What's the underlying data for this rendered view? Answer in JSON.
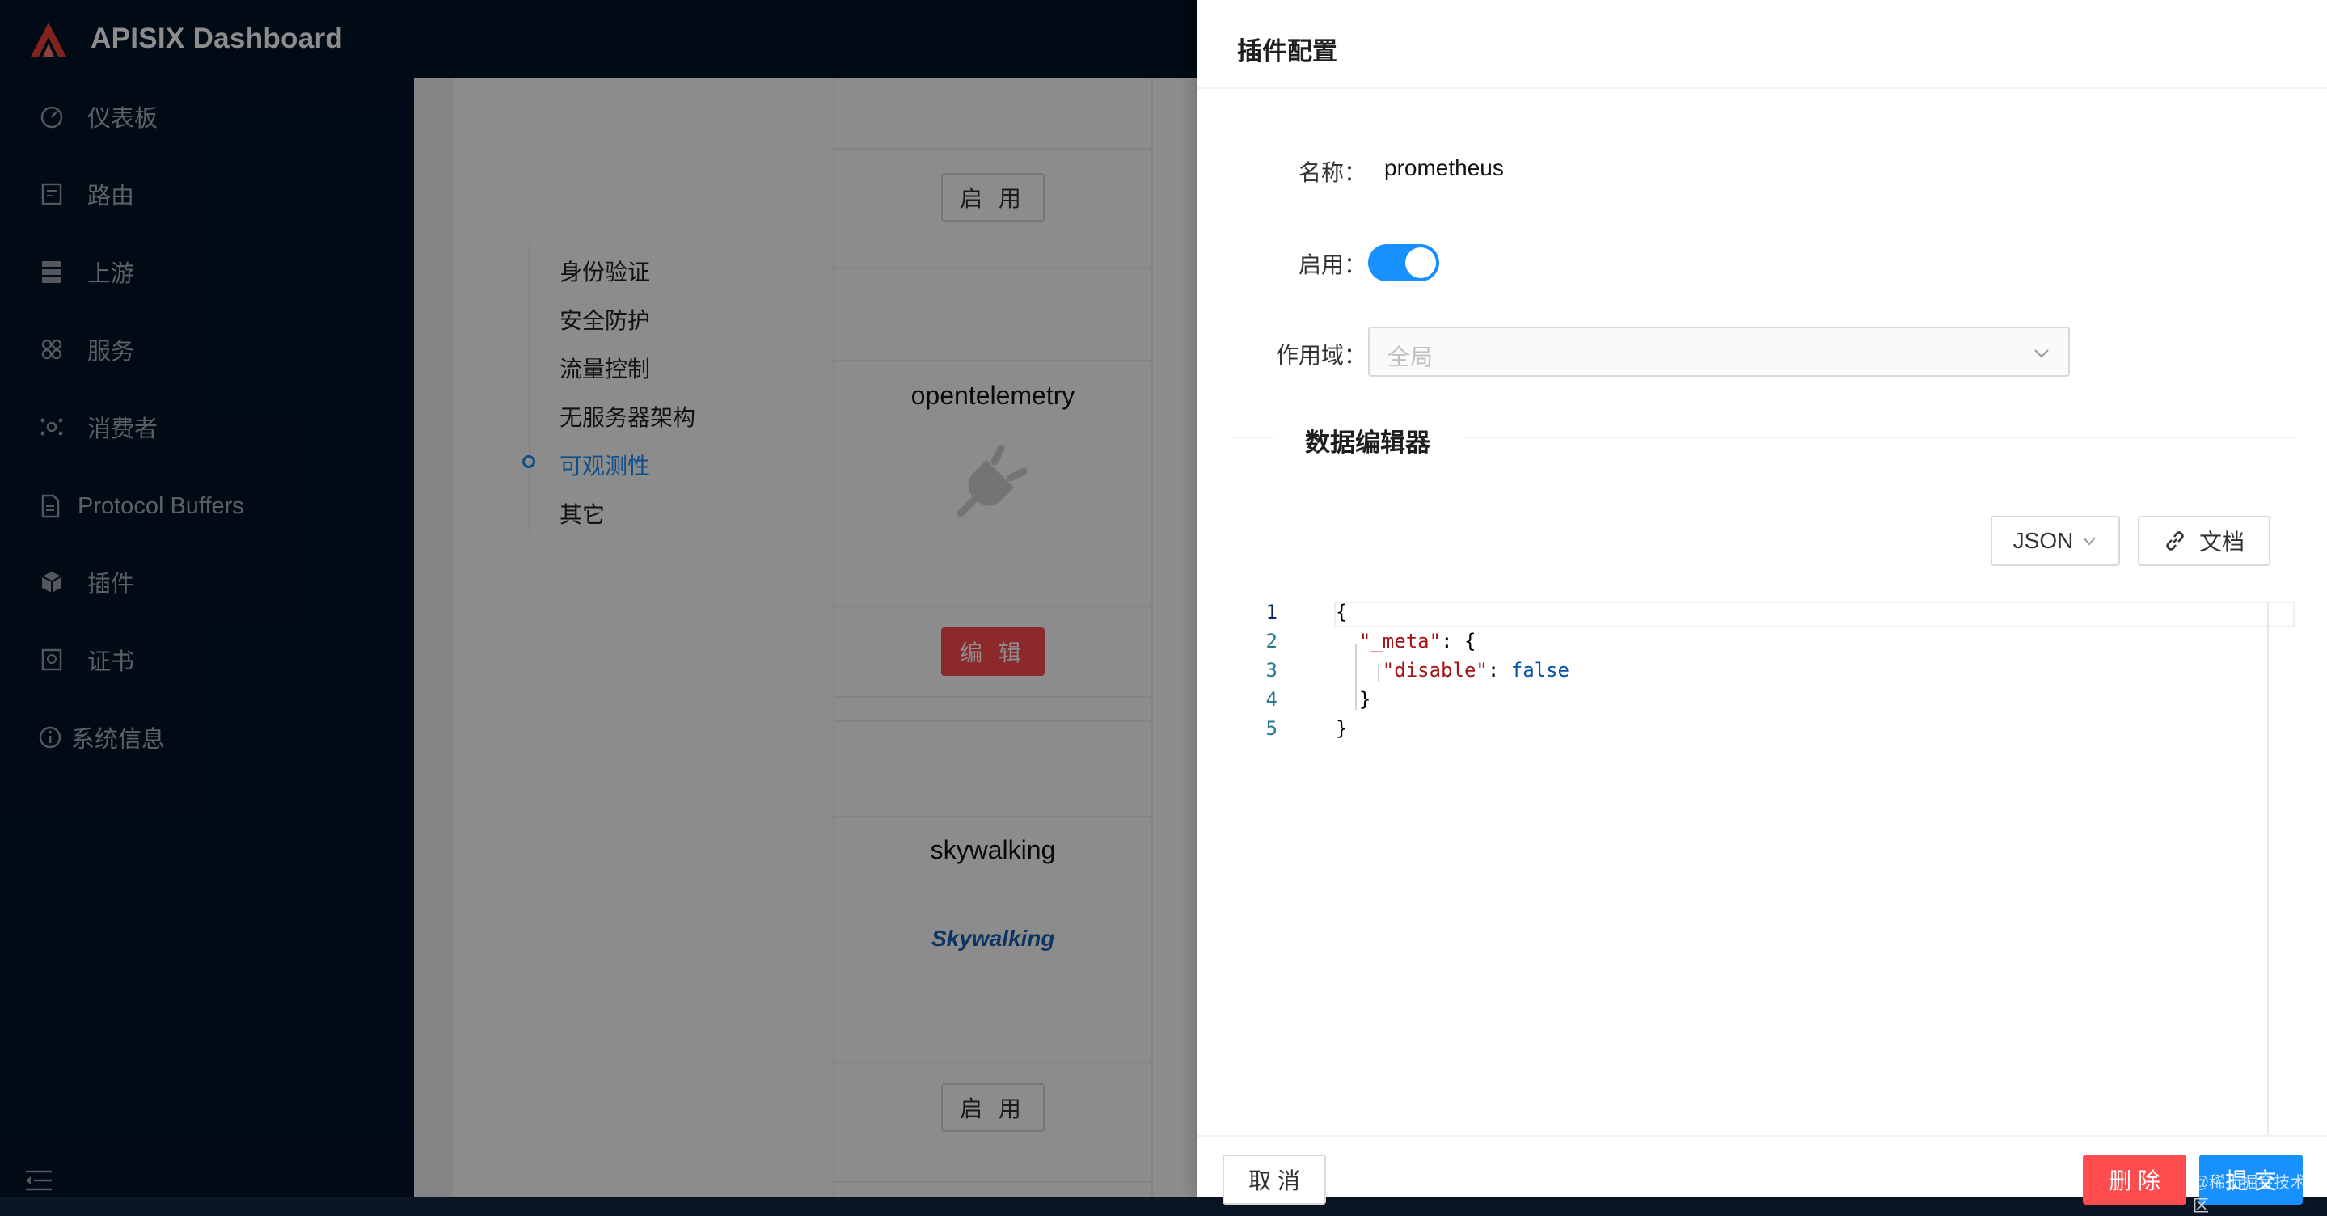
{
  "app": {
    "brand": "APISIX Dashboard"
  },
  "sidebar": {
    "items": [
      {
        "label": "仪表板",
        "icon": "dashboard-icon"
      },
      {
        "label": "路由",
        "icon": "route-icon"
      },
      {
        "label": "上游",
        "icon": "upstream-icon"
      },
      {
        "label": "服务",
        "icon": "service-icon"
      },
      {
        "label": "消费者",
        "icon": "consumer-icon"
      },
      {
        "label": "Protocol Buffers",
        "icon": "file-icon"
      },
      {
        "label": "插件",
        "icon": "plugin-icon"
      },
      {
        "label": "证书",
        "icon": "certificate-icon"
      },
      {
        "label": "系统信息",
        "icon": "info-icon"
      }
    ]
  },
  "plugins_page": {
    "categories": [
      "身份验证",
      "安全防护",
      "流量控制",
      "无服务器架构",
      "可观测性",
      "其它"
    ],
    "active_category": "可观测性",
    "cards": [
      {
        "name": "opentelemetry",
        "action": "编 辑"
      },
      {
        "name": "skywalking",
        "action": "启 用",
        "logo_text": "Skywalking"
      }
    ],
    "top_card_action": "启 用"
  },
  "drawer": {
    "title": "插件配置",
    "name_label": "名称：",
    "name_value": "prometheus",
    "enable_label": "启用：",
    "enabled": true,
    "scope_label": "作用域：",
    "scope_value": "全局",
    "editor_section": "数据编辑器",
    "format": "JSON",
    "docs_button": "文档",
    "code_lines": [
      "{",
      "  \"_meta\": {",
      "    \"disable\": false",
      "  }",
      "}"
    ],
    "line_numbers": [
      "1",
      "2",
      "3",
      "4",
      "5"
    ],
    "cancel_button": "取 消",
    "delete_button": "删 除",
    "submit_button": "提 交"
  },
  "colors": {
    "primary": "#1890ff",
    "danger": "#ff4d4f",
    "sidebar_bg": "#001529"
  },
  "watermark": "@稀土掘金技术社区"
}
